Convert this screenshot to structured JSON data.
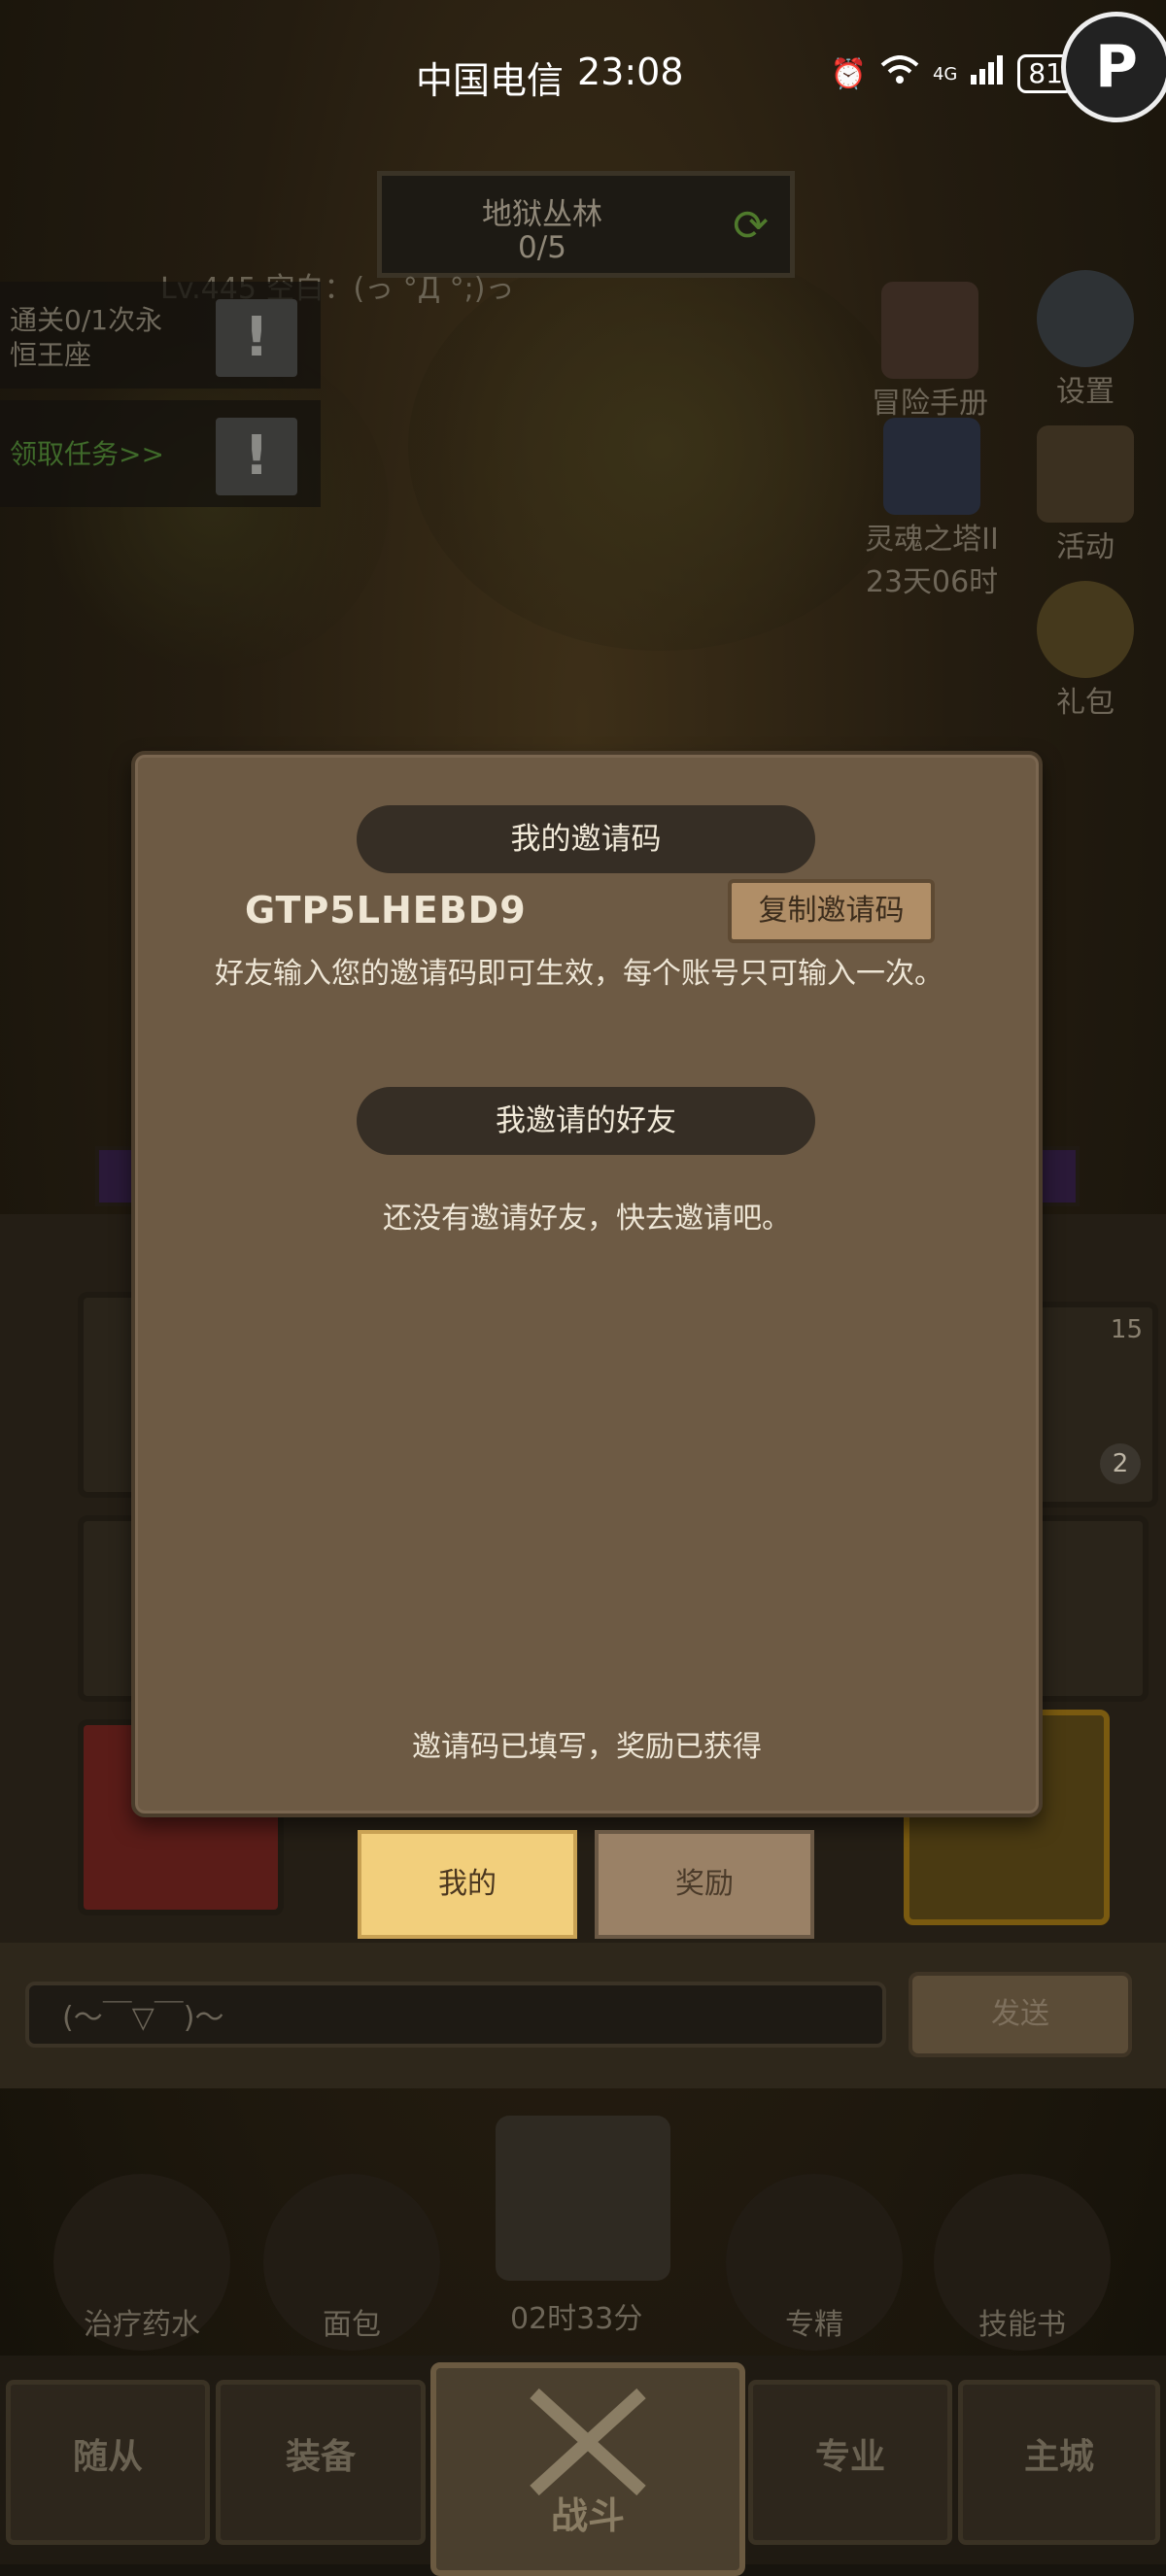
{
  "status_bar": {
    "carrier": "中国电信",
    "time": "23:08",
    "network": "4G",
    "battery": "81"
  },
  "stage": {
    "name": "地狱丛林",
    "progress": "0/5"
  },
  "player_line": "Lv.445 空白：(っ °Д °;)っ",
  "quests": [
    {
      "text_line1": "通关0/1次永",
      "text_line2": "恒王座"
    },
    {
      "text_line1": "领取任务>>"
    }
  ],
  "side_menu": [
    {
      "label": "冒险手册",
      "icon": "book-icon"
    },
    {
      "label": "设置",
      "icon": "gear-icon"
    },
    {
      "label": "灵魂之塔II",
      "sub": "23天06时",
      "icon": "tower-icon"
    },
    {
      "label": "活动",
      "icon": "scroll-icon"
    },
    {
      "label": "礼包",
      "icon": "gift-icon"
    }
  ],
  "background_badges": {
    "level": "15",
    "count": "2"
  },
  "invite_popup": {
    "code_header": "我的邀请码",
    "code": "GTP5LHEBD9",
    "copy_button": "复制邀请码",
    "description": "好友输入您的邀请码即可生效，每个账号只可输入一次。",
    "friends_header": "我邀请的好友",
    "empty_text": "还没有邀请好友，快去邀请吧。",
    "footer_text": "邀请码已填写，奖励已获得"
  },
  "tabs": {
    "mine": "我的",
    "reward": "奖励"
  },
  "chat": {
    "placeholder": "(～￣▽￣)～",
    "send": "发送"
  },
  "consumables": [
    {
      "label": "治疗药水",
      "icon": "potion-icon"
    },
    {
      "label": "面包",
      "icon": "bread-icon"
    },
    {
      "label": "02时33分",
      "icon": "chest-icon"
    },
    {
      "label": "专精",
      "icon": "mastery-icon"
    },
    {
      "label": "技能书",
      "icon": "skillbook-icon"
    }
  ],
  "bottom_nav": {
    "followers": "随从",
    "equipment": "装备",
    "battle": "战斗",
    "profession": "专业",
    "city": "主城"
  }
}
